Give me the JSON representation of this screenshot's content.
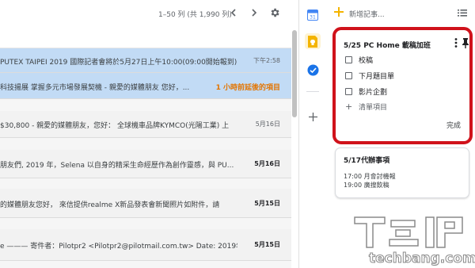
{
  "mail": {
    "pager_text": "1–50 列 (共 1,990 列)",
    "rows": [
      {
        "snippet": "PUTEX TAIPEI 2019 國際記者會將於5月27日上午10:00(09:00開始報到)",
        "date": "下午2:58",
        "date_bold": false,
        "late_badge": "",
        "selected": true
      },
      {
        "snippet": "科技揚展 掌握多元市場發展契機 - 親愛的媒體朋友 您好，...",
        "date": "",
        "date_bold": false,
        "late_badge": "1 小時前延後的項目",
        "selected": true
      },
      {
        "snippet": "$30,800 - 親愛的媒體朋友，您好： 全球機車品牌KYMCO(光陽工業) 上",
        "date": "5月16日",
        "date_bold": false,
        "late_badge": "",
        "selected": false
      },
      {
        "snippet": "朋友們, 2019 年，Selena 以自身的精采生命經歷作為創作靈感，與 PU...",
        "date": "5月16日",
        "date_bold": true,
        "late_badge": "",
        "selected": false
      },
      {
        "snippet": "的媒體朋友您好， 來信提供realme X新品發表會新聞照片如附件，請",
        "date": "5月15日",
        "date_bold": true,
        "late_badge": "",
        "selected": false
      },
      {
        "snippet": "e ——— 寄件者：Pilotpr2 <Pilotpr2@pilotmail.com.tw> Date: 2019年...",
        "date": "5月15日",
        "date_bold": true,
        "late_badge": "",
        "selected": false
      }
    ]
  },
  "rail": {
    "icons": [
      "calendar-icon",
      "keep-icon",
      "tasks-icon",
      "add-icon"
    ],
    "colors": {
      "calendar": "#4285f4",
      "keep": "#f4b400",
      "tasks": "#1a73e8"
    }
  },
  "keep": {
    "new_note_label": "新增記事...",
    "active_note": {
      "title": "5/25 PC Home 載稿加班",
      "items": [
        "校稿",
        "下月題目單",
        "影片企劃"
      ],
      "add_item_label": "清單項目",
      "done_label": "完成"
    },
    "second_note": {
      "title": "5/17代辦事項",
      "lines": [
        "17:00 月會討機報",
        "19:00 廣搜飲稿"
      ]
    }
  },
  "watermark": {
    "url": "techbang.com"
  },
  "colors": {
    "highlight_border": "#d0121b",
    "selected_row": "#c2dbf5",
    "late_badge": "#e37400"
  }
}
